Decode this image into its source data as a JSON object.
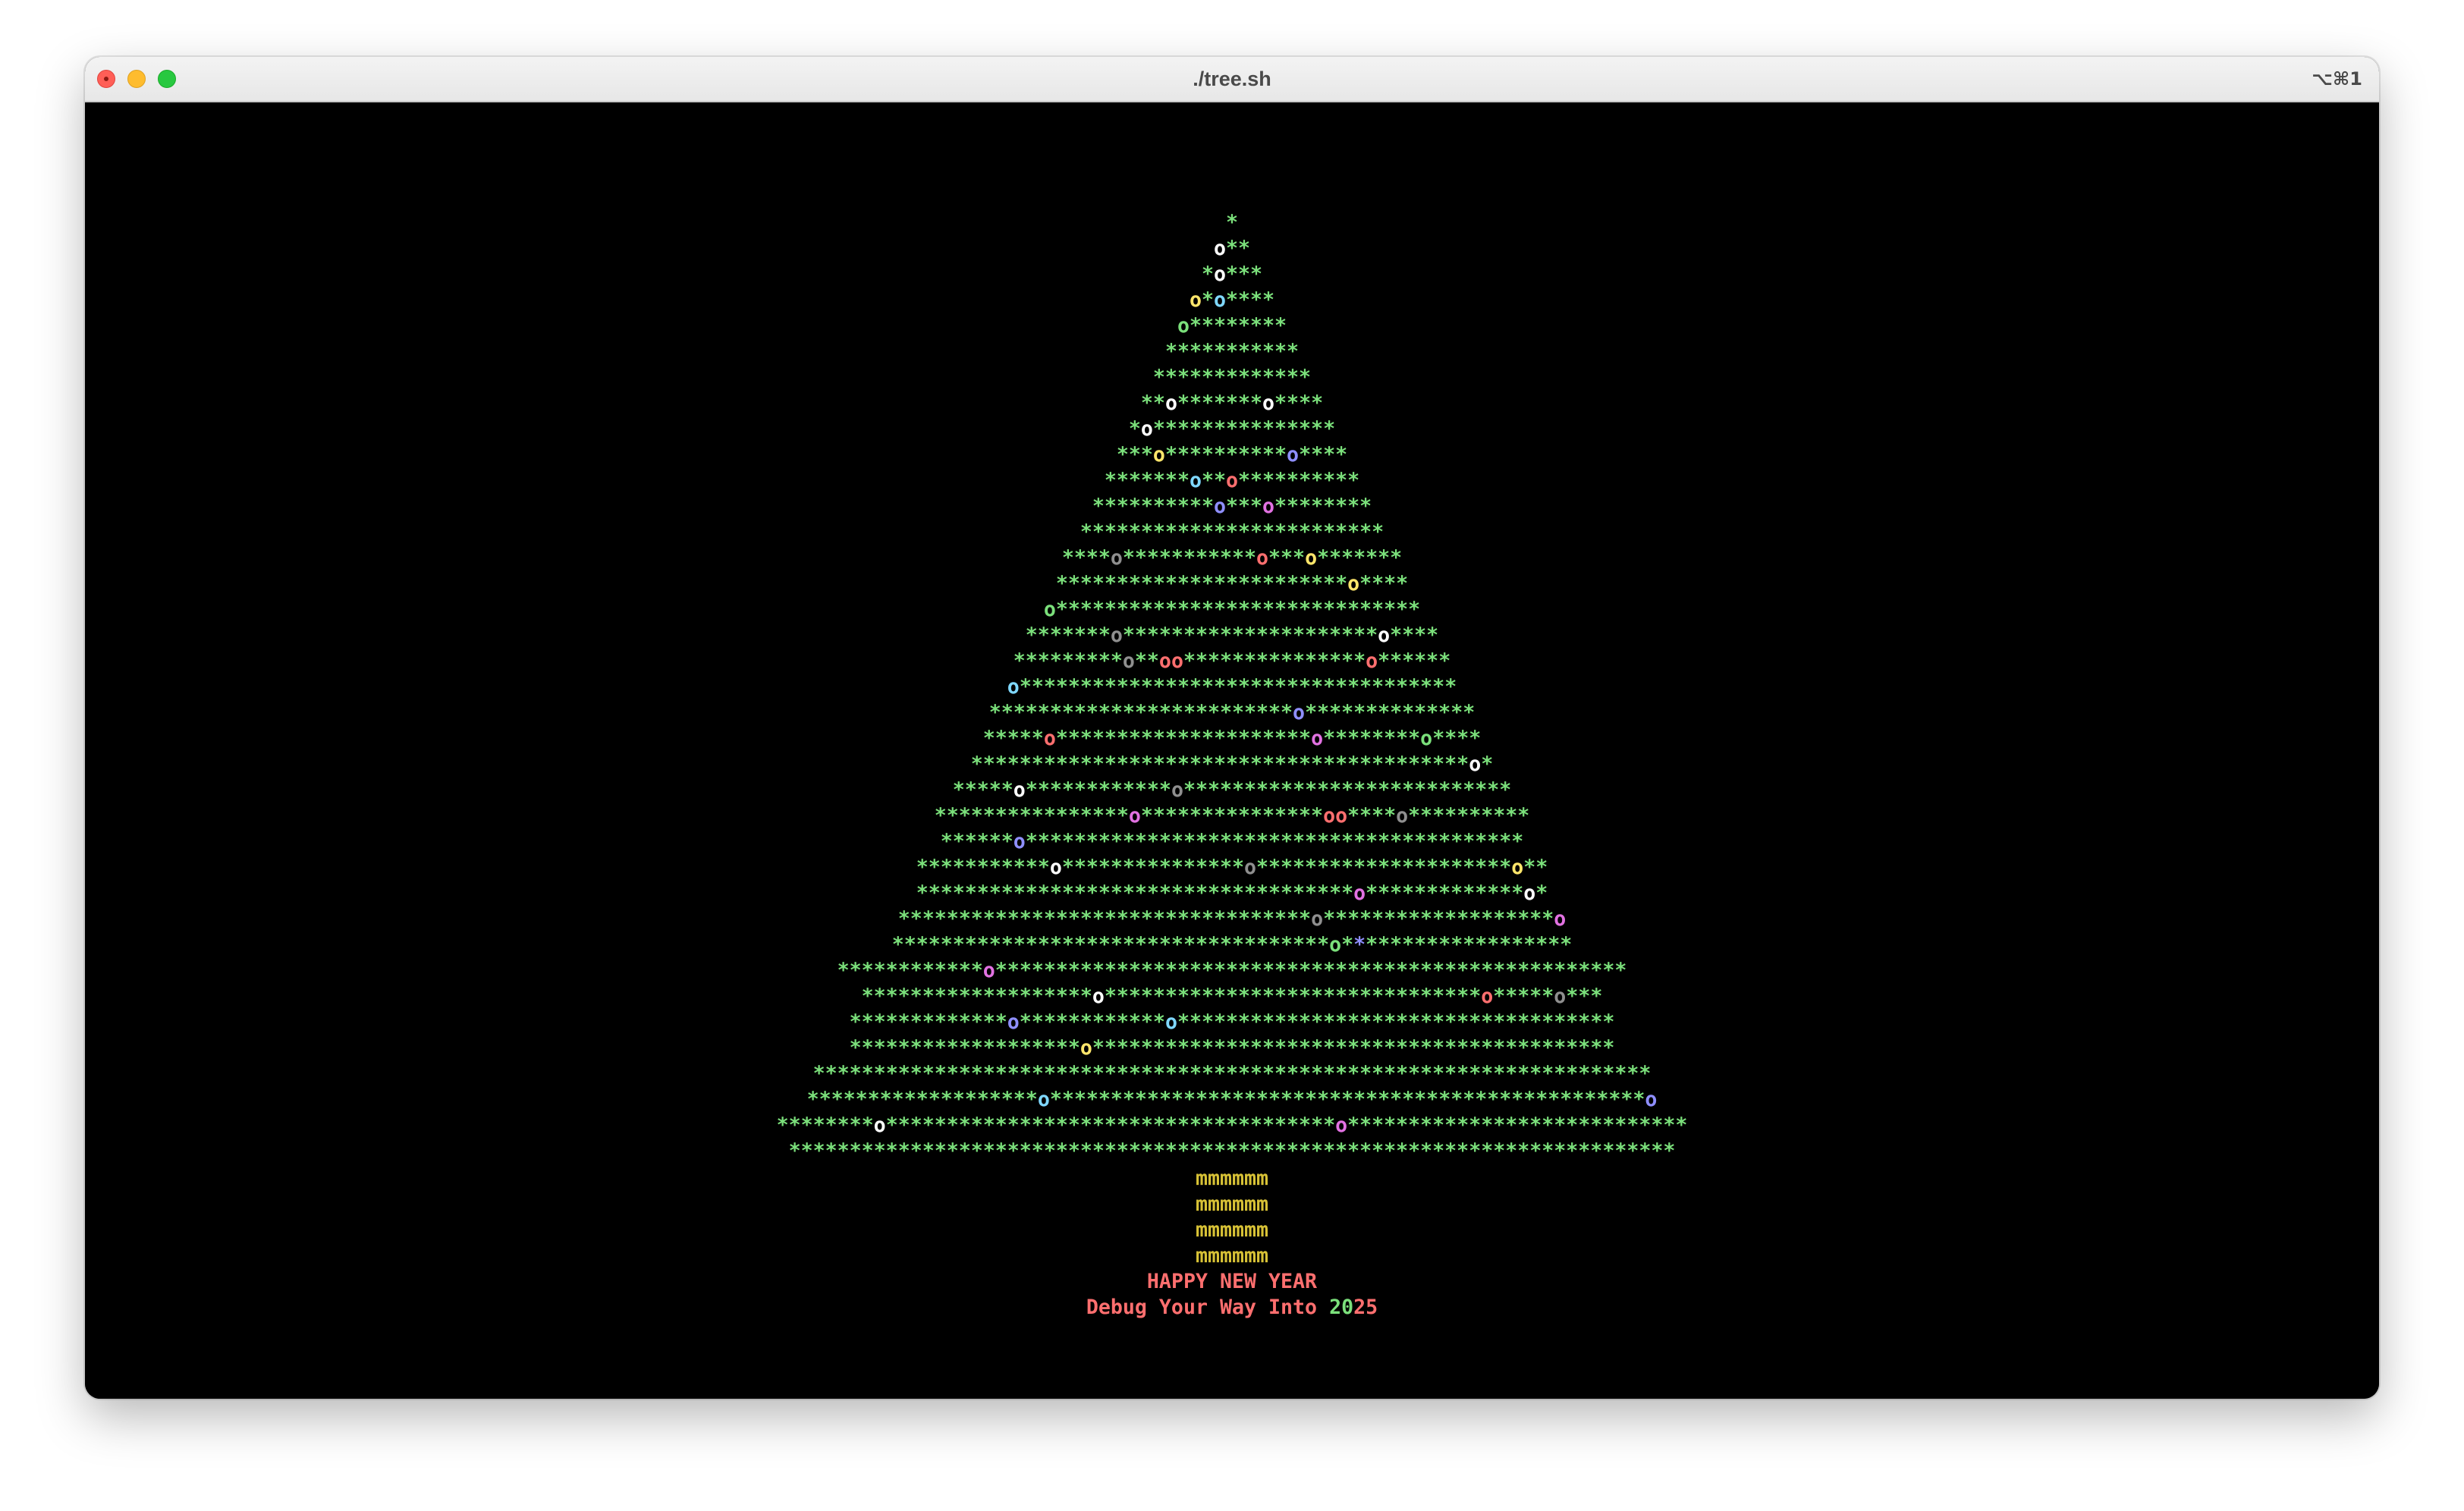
{
  "window": {
    "title": "./tree.sh",
    "shortcut": "⌥⌘1"
  },
  "colors": {
    "leaf": "#7be07b",
    "trunk": "#d8c236",
    "message": "#ff6f6f",
    "message_accent": "#7be07b",
    "background": "#000000",
    "ornaments": [
      "#ffffff",
      "#ff6f6f",
      "#8f8fff",
      "#e272e2",
      "#ffe66b",
      "#7fd8ff",
      "#8f8f8f"
    ]
  },
  "tree": {
    "rows": [
      {
        "text": "*",
        "ornaments": []
      },
      {
        "text": "o**",
        "ornaments": [
          {
            "i": 0,
            "c": "#ffffff"
          }
        ]
      },
      {
        "text": "*o***",
        "ornaments": [
          {
            "i": 1,
            "c": "#ffffff"
          }
        ]
      },
      {
        "text": "o*o****",
        "ornaments": [
          {
            "i": 0,
            "c": "#ffe66b"
          },
          {
            "i": 2,
            "c": "#7fd8ff"
          }
        ]
      },
      {
        "text": "o********",
        "ornaments": [
          {
            "i": 0,
            "c": "#7be07b"
          }
        ]
      },
      {
        "text": "***********",
        "ornaments": []
      },
      {
        "text": "*************",
        "ornaments": []
      },
      {
        "text": "**o*******o****",
        "ornaments": [
          {
            "i": 2,
            "c": "#ffffff"
          },
          {
            "i": 10,
            "c": "#ffffff"
          }
        ]
      },
      {
        "text": "*o***************",
        "ornaments": [
          {
            "i": 1,
            "c": "#ffffff"
          }
        ]
      },
      {
        "text": "***o**********o****",
        "ornaments": [
          {
            "i": 3,
            "c": "#ffe66b"
          },
          {
            "i": 14,
            "c": "#8f8fff"
          }
        ]
      },
      {
        "text": "*******o**o**********",
        "ornaments": [
          {
            "i": 7,
            "c": "#7fd8ff"
          },
          {
            "i": 10,
            "c": "#ff6f6f"
          }
        ]
      },
      {
        "text": "**********o***o********",
        "ornaments": [
          {
            "i": 10,
            "c": "#8f8fff"
          },
          {
            "i": 14,
            "c": "#e272e2"
          }
        ]
      },
      {
        "text": "*************************",
        "ornaments": []
      },
      {
        "text": "****o***********o***o*******",
        "ornaments": [
          {
            "i": 4,
            "c": "#8f8f8f"
          },
          {
            "i": 16,
            "c": "#ff6f6f"
          },
          {
            "i": 20,
            "c": "#ffe66b"
          }
        ]
      },
      {
        "text": "************************o****",
        "ornaments": [
          {
            "i": 24,
            "c": "#ffe66b"
          }
        ]
      },
      {
        "text": "o******************************",
        "ornaments": [
          {
            "i": 0,
            "c": "#7be07b"
          }
        ]
      },
      {
        "text": "*******o*********************o****",
        "ornaments": [
          {
            "i": 7,
            "c": "#8f8f8f"
          },
          {
            "i": 29,
            "c": "#ffffff"
          }
        ]
      },
      {
        "text": "*********o**oo***************o******",
        "ornaments": [
          {
            "i": 9,
            "c": "#8f8f8f"
          },
          {
            "i": 12,
            "c": "#ff6f6f"
          },
          {
            "i": 13,
            "c": "#ff6f6f"
          },
          {
            "i": 29,
            "c": "#ff6f6f"
          }
        ]
      },
      {
        "text": "o************************************",
        "ornaments": [
          {
            "i": 0,
            "c": "#7fd8ff"
          }
        ]
      },
      {
        "text": "*************************o**************",
        "ornaments": [
          {
            "i": 25,
            "c": "#8f8fff"
          }
        ]
      },
      {
        "text": "*****o*********************o********o****",
        "ornaments": [
          {
            "i": 5,
            "c": "#ff6f6f"
          },
          {
            "i": 27,
            "c": "#e272e2"
          },
          {
            "i": 36,
            "c": "#7be07b"
          }
        ]
      },
      {
        "text": "*****************************************o*",
        "ornaments": [
          {
            "i": 41,
            "c": "#ffffff"
          }
        ]
      },
      {
        "text": "*****o************o***************************",
        "ornaments": [
          {
            "i": 5,
            "c": "#ffffff"
          },
          {
            "i": 18,
            "c": "#8f8f8f"
          }
        ]
      },
      {
        "text": "****************o***************oo****o**********",
        "ornaments": [
          {
            "i": 16,
            "c": "#e272e2"
          },
          {
            "i": 32,
            "c": "#ff6f6f"
          },
          {
            "i": 33,
            "c": "#ff6f6f"
          },
          {
            "i": 38,
            "c": "#8f8f8f"
          }
        ]
      },
      {
        "text": "******o*****************************************",
        "ornaments": [
          {
            "i": 6,
            "c": "#8f8fff"
          }
        ]
      },
      {
        "text": "***********o***************o*********************o**",
        "ornaments": [
          {
            "i": 11,
            "c": "#ffffff"
          },
          {
            "i": 27,
            "c": "#8f8f8f"
          },
          {
            "i": 49,
            "c": "#ffe66b"
          }
        ]
      },
      {
        "text": "************************************o*************o*",
        "ornaments": [
          {
            "i": 36,
            "c": "#e272e2"
          },
          {
            "i": 50,
            "c": "#ffffff"
          }
        ]
      },
      {
        "text": "**********************************o*******************o",
        "ornaments": [
          {
            "i": 34,
            "c": "#8f8f8f"
          },
          {
            "i": 54,
            "c": "#e272e2"
          }
        ]
      },
      {
        "text": "************************************o*******************",
        "ornaments": [
          {
            "i": 38,
            "c": "#8f8fff"
          }
        ]
      },
      {
        "text": "************o****************************************************",
        "ornaments": [
          {
            "i": 12,
            "c": "#e272e2"
          }
        ]
      },
      {
        "text": "*******************o*******************************o*****o***",
        "ornaments": [
          {
            "i": 19,
            "c": "#ffffff"
          },
          {
            "i": 51,
            "c": "#ff6f6f"
          },
          {
            "i": 57,
            "c": "#8f8f8f"
          }
        ]
      },
      {
        "text": "*************o************o************************************",
        "ornaments": [
          {
            "i": 13,
            "c": "#8f8fff"
          },
          {
            "i": 26,
            "c": "#7fd8ff"
          }
        ]
      },
      {
        "text": "*******************o*******************************************",
        "ornaments": [
          {
            "i": 19,
            "c": "#ffe66b"
          }
        ]
      },
      {
        "text": "*********************************************************************",
        "ornaments": []
      },
      {
        "text": "*******************o*************************************************o",
        "ornaments": [
          {
            "i": 19,
            "c": "#7fd8ff"
          },
          {
            "i": 69,
            "c": "#8f8fff"
          }
        ]
      },
      {
        "text": "********o*************************************o****************************",
        "ornaments": [
          {
            "i": 8,
            "c": "#ffffff"
          },
          {
            "i": 46,
            "c": "#e272e2"
          }
        ]
      },
      {
        "text": "*************************************************************************",
        "ornaments": []
      }
    ]
  },
  "trunk": [
    "mmmmmm",
    "mmmmmm",
    "mmmmmm",
    "mmmmmm"
  ],
  "message": {
    "greeting": "HAPPY NEW YEAR",
    "tagline_prefix": "Debug Your Way Into ",
    "tagline_year_part1": "20",
    "tagline_year_part2": "25"
  }
}
